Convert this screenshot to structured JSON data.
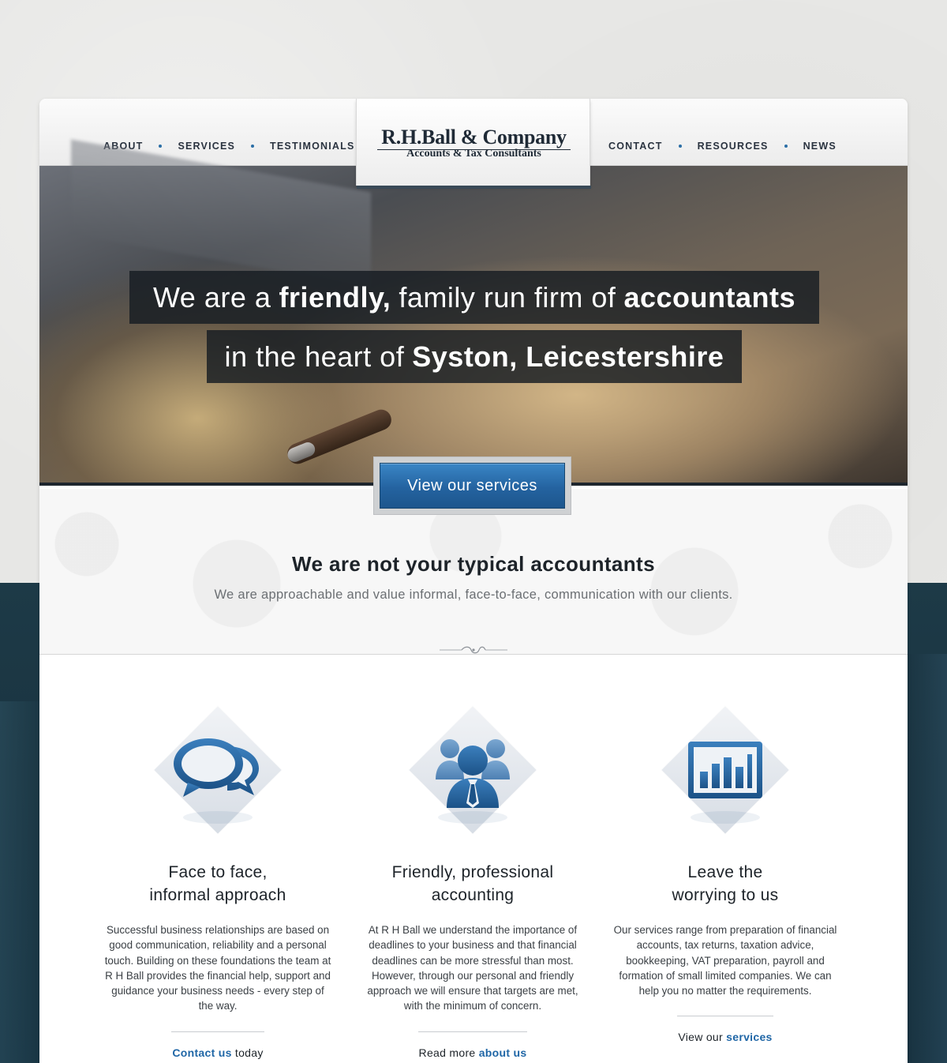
{
  "nav": {
    "left": [
      {
        "label": "ABOUT"
      },
      {
        "label": "SERVICES"
      },
      {
        "label": "TESTIMONIALS"
      }
    ],
    "right": [
      {
        "label": "CONTACT"
      },
      {
        "label": "RESOURCES"
      },
      {
        "label": "NEWS"
      }
    ]
  },
  "logo": {
    "name": "R.H.Ball & Company",
    "subtitle": "Accounts & Tax Consultants"
  },
  "hero": {
    "line1": {
      "p1": "We are a",
      "b1": "friendly,",
      "p2": "family run firm of",
      "b2": "accountants"
    },
    "line2": {
      "p1": "in the heart of",
      "b1": "Syston, Leicestershire"
    },
    "cta": "View our services"
  },
  "tagline": {
    "title": "We are not your typical accountants",
    "subtitle": "We are approachable and value informal, face-to-face, communication with our clients."
  },
  "features": [
    {
      "icon": "speech-bubbles-icon",
      "title_line1": "Face to face,",
      "title_line2": "informal approach",
      "text": "Successful business relationships are based on good communication, reliability and a personal touch. Building on these foundations the team at R H Ball provides the financial help, support and guidance your business needs - every step of the way.",
      "link_pre": "",
      "link_text": "Contact us",
      "link_post": " today"
    },
    {
      "icon": "team-icon",
      "title_line1": "Friendly, professional",
      "title_line2": "accounting",
      "text": "At R H Ball we understand the importance of deadlines to your business and that financial deadlines can be more stressful than most. However, through our personal and friendly approach we will ensure that targets are met, with the minimum of concern.",
      "link_pre": "Read more ",
      "link_text": "about us",
      "link_post": ""
    },
    {
      "icon": "bar-chart-icon",
      "title_line1": "Leave the",
      "title_line2": "worrying to us",
      "text": "Our services range from preparation of financial accounts, tax returns, taxation advice, bookkeeping, VAT preparation, payroll and formation of small limited companies. We can help you no matter the requirements.",
      "link_pre": "View our ",
      "link_text": "services",
      "link_post": ""
    }
  ],
  "colors": {
    "accent": "#1f66a6",
    "icon_blue": "#22609a",
    "dark_band": "#1d3a47"
  }
}
